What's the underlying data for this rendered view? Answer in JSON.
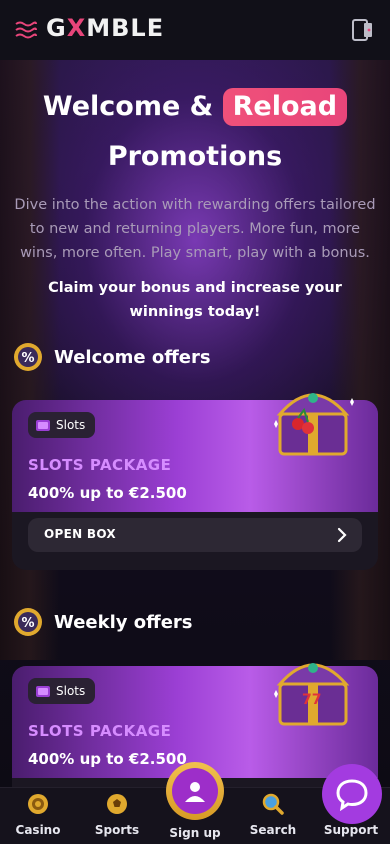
{
  "header": {
    "logo_prefix": "G",
    "logo_x": "X",
    "logo_suffix": "MBLE"
  },
  "hero": {
    "title_part1": "Welcome &",
    "title_highlight": "Reload",
    "title_part2": "Promotions",
    "description": "Dive into the action with rewarding offers tailored to new and returning players. More fun, more wins, more often. Play smart, play with a bonus.",
    "claim": "Claim your bonus and increase your winnings today!"
  },
  "sections": [
    {
      "title": "Welcome offers",
      "card": {
        "tag": "Slots",
        "package": "SLOTS PACKAGE",
        "value": "400% up to €2.500",
        "button": "OPEN BOX"
      }
    },
    {
      "title": "Weekly offers",
      "card": {
        "tag": "Slots",
        "package": "SLOTS PACKAGE",
        "value": "400% up to €2.500"
      }
    }
  ],
  "badge_symbol": "%",
  "bottom_nav": {
    "items": [
      {
        "label": "Casino",
        "icon": "casino-chip-icon"
      },
      {
        "label": "Sports",
        "icon": "soccer-ball-icon"
      },
      {
        "label": "Sign up",
        "icon": "user-icon"
      },
      {
        "label": "Search",
        "icon": "search-icon"
      },
      {
        "label": "Support",
        "icon": "chat-icon"
      }
    ]
  },
  "colors": {
    "accent_pink": "#e8457a",
    "accent_purple": "#a33be0",
    "gold": "#e0a92e",
    "package_text": "#d68cff"
  }
}
